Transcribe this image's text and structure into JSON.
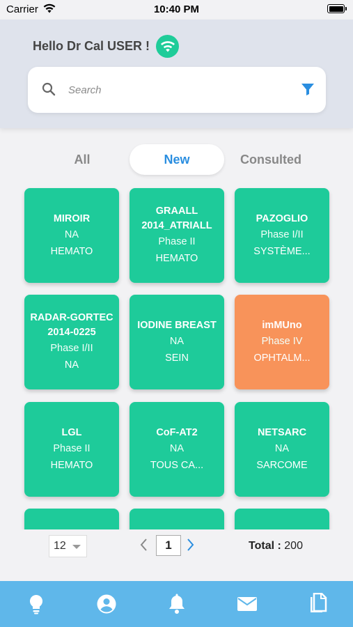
{
  "status_bar": {
    "carrier": "Carrier",
    "time": "10:40 PM"
  },
  "header": {
    "greeting": "Hello Dr Cal USER !",
    "connection_icon": "wifi-icon",
    "accent_color": "#1fcc99"
  },
  "search": {
    "placeholder": "Search",
    "value": "",
    "filter_icon": "filter-icon"
  },
  "tabs": [
    {
      "label": "All",
      "active": false
    },
    {
      "label": "New",
      "active": true
    },
    {
      "label": "Consulted",
      "active": false
    }
  ],
  "studies": [
    {
      "name": "MIROIR",
      "phase": "NA",
      "domain": "HEMATO",
      "color": "#1ecb9a"
    },
    {
      "name": "GRAALL 2014_ATRIALL",
      "phase": "Phase II",
      "domain": "HEMATO",
      "color": "#1ecb9a"
    },
    {
      "name": "PAZOGLIO",
      "phase": "Phase I/II",
      "domain": "SYSTÈME...",
      "color": "#1ecb9a"
    },
    {
      "name": "RADAR-GORTEC 2014-0225",
      "phase": "Phase I/II",
      "domain": "NA",
      "color": "#1ecb9a"
    },
    {
      "name": "IODINE BREAST",
      "phase": "NA",
      "domain": "SEIN",
      "color": "#1ecb9a"
    },
    {
      "name": "imMUno",
      "phase": "Phase IV",
      "domain": "OPHTALM...",
      "color": "#f8935a"
    },
    {
      "name": "LGL",
      "phase": "Phase II",
      "domain": "HEMATO",
      "color": "#1ecb9a"
    },
    {
      "name": "CoF-AT2",
      "phase": "NA",
      "domain": "TOUS CA...",
      "color": "#1ecb9a"
    },
    {
      "name": "NETSARC",
      "phase": "NA",
      "domain": "SARCOME",
      "color": "#1ecb9a"
    }
  ],
  "pagination": {
    "page_size": "12",
    "current_page": "1",
    "total_label": "Total :",
    "total_value": "200"
  },
  "bottom_nav": [
    {
      "icon": "lightbulb-icon"
    },
    {
      "icon": "user-icon"
    },
    {
      "icon": "bell-icon"
    },
    {
      "icon": "mail-icon"
    },
    {
      "icon": "copy-icon"
    }
  ],
  "colors": {
    "nav_bar": "#5fb7ea",
    "active_tab": "#2a8ee0",
    "card_green": "#1ecb9a",
    "card_orange": "#f8935a"
  }
}
